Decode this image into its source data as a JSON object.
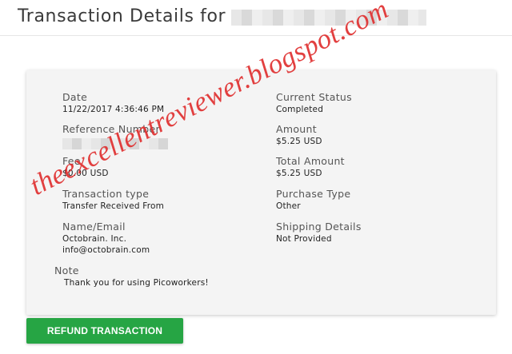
{
  "page": {
    "title": "Transaction Details for"
  },
  "details": {
    "date_label": "Date",
    "date_value": "11/22/2017 4:36:46 PM",
    "current_status_label": "Current Status",
    "current_status_value": "Completed",
    "reference_label": "Reference Number",
    "amount_label": "Amount",
    "amount_value": "$5.25 USD",
    "fee_label": "Fee",
    "fee_value": "$0.00 USD",
    "total_amount_label": "Total Amount",
    "total_amount_value": "$5.25 USD",
    "transaction_type_label": "Transaction type",
    "transaction_type_value": "Transfer Received From",
    "purchase_type_label": "Purchase Type",
    "purchase_type_value": "Other",
    "name_email_label": "Name/Email",
    "name_value": "Octobrain. Inc.",
    "email_value": "info@octobrain.com",
    "shipping_label": "Shipping Details",
    "shipping_value": "Not Provided",
    "note_label": "Note",
    "note_value": "Thank you for using Picoworkers!"
  },
  "actions": {
    "refund_label": "REFUND TRANSACTION"
  },
  "watermark": {
    "text": "theexcellentreviewer.blogspot.com"
  },
  "colors": {
    "refund_button": "#26a544",
    "watermark": "#e03030",
    "card_background": "#f4f4f4"
  }
}
